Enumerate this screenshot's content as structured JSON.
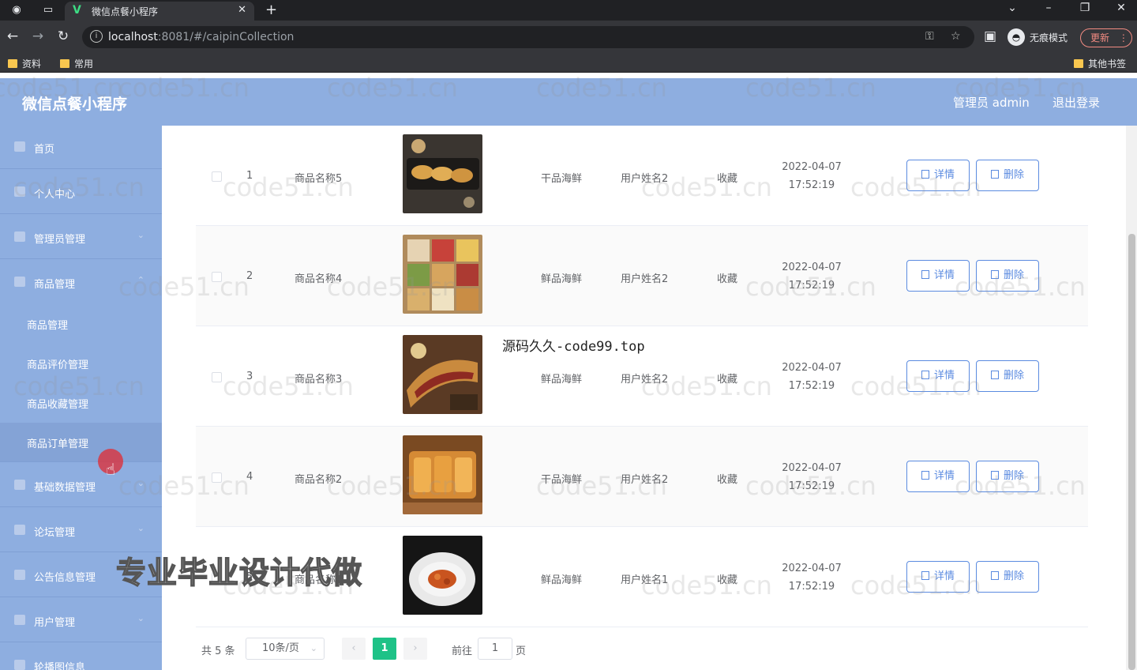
{
  "browser": {
    "tab_title": "微信点餐小程序",
    "url_host": "localhost",
    "url_rest": ":8081/#/caipinCollection",
    "incognito_label": "无痕模式",
    "update_label": "更新",
    "bookmarks": [
      "资料",
      "常用"
    ],
    "bookmarks_right": "其他书签"
  },
  "header": {
    "title": "微信点餐小程序",
    "admin": "管理员 admin",
    "logout": "退出登录"
  },
  "sidebar": {
    "items": [
      {
        "label": "首页"
      },
      {
        "label": "个人中心"
      },
      {
        "label": "管理员管理"
      },
      {
        "label": "商品管理"
      },
      {
        "label": "基础数据管理"
      },
      {
        "label": "论坛管理"
      },
      {
        "label": "公告信息管理"
      },
      {
        "label": "用户管理"
      },
      {
        "label": "轮播图信息"
      }
    ],
    "sub_items": [
      {
        "label": "商品管理"
      },
      {
        "label": "商品评价管理"
      },
      {
        "label": "商品收藏管理"
      },
      {
        "label": "商品订单管理"
      }
    ]
  },
  "table": {
    "rows": [
      {
        "index": "1",
        "name": "商品名称5",
        "category": "干品海鲜",
        "user": "用户姓名2",
        "type": "收藏",
        "date": "2022-04-07",
        "time": "17:52:19"
      },
      {
        "index": "2",
        "name": "商品名称4",
        "category": "鲜品海鲜",
        "user": "用户姓名2",
        "type": "收藏",
        "date": "2022-04-07",
        "time": "17:52:19"
      },
      {
        "index": "3",
        "name": "商品名称3",
        "category": "鲜品海鲜",
        "user": "用户姓名2",
        "type": "收藏",
        "date": "2022-04-07",
        "time": "17:52:19"
      },
      {
        "index": "4",
        "name": "商品名称2",
        "category": "干品海鲜",
        "user": "用户姓名2",
        "type": "收藏",
        "date": "2022-04-07",
        "time": "17:52:19"
      },
      {
        "index": "5",
        "name": "商品名称1",
        "category": "鲜品海鲜",
        "user": "用户姓名1",
        "type": "收藏",
        "date": "2022-04-07",
        "time": "17:52:19"
      }
    ],
    "detail_label": "详情",
    "delete_label": "删除"
  },
  "pagination": {
    "total": "共 5 条",
    "page_size": "10条/页",
    "current": "1",
    "goto_label": "前往",
    "goto_value": "1",
    "page_label": "页"
  },
  "overlays": {
    "watermark": "code51.cn",
    "source_text": "源码久久-code99.top",
    "promo_text": "专业毕业设计代做"
  },
  "colors": {
    "header_bg": "#8eaee0",
    "accent": "#5b8be0",
    "pager_active": "#1ec287"
  }
}
